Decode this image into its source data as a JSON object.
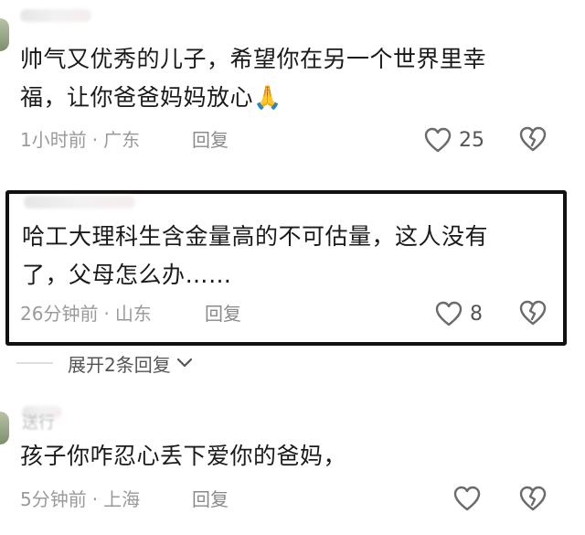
{
  "comments": [
    {
      "text_line1": "帅气又优秀的儿子，希望你在另一个世界里幸",
      "text_line2": "福，让你爸爸妈妈放心",
      "emoji": "🙏",
      "time": "1小时前",
      "location": "广东",
      "reply_label": "回复",
      "likes": "25"
    },
    {
      "text_line1": "哈工大理科生含金量高的不可估量，这人没有",
      "text_line2": "了，父母怎么办……",
      "time": "26分钟前",
      "location": "山东",
      "reply_label": "回复",
      "likes": "8",
      "expand_label": "展开2条回复"
    },
    {
      "username_partial": "送行",
      "text_line1": "孩子你咋忍心丢下爱你的爸妈，",
      "time": "5分钟前",
      "location": "上海",
      "reply_label": "回复"
    }
  ],
  "separator": "·",
  "icons": {
    "like": "heart-outline-icon",
    "dislike": "broken-heart-icon",
    "expand": "chevron-down-icon"
  },
  "colors": {
    "text": "#1a1a1a",
    "meta": "#9a9a9a",
    "highlight_border": "#111111"
  }
}
